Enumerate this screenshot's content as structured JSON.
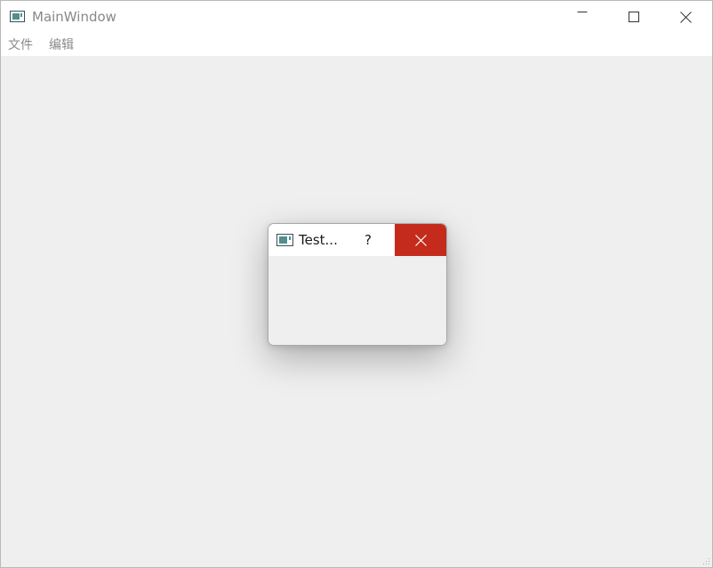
{
  "window": {
    "title": "MainWindow",
    "icon": "app-window-icon",
    "controls": {
      "minimize_icon": "minimize-icon",
      "maximize_icon": "maximize-icon",
      "close_icon": "close-icon"
    }
  },
  "menubar": {
    "items": [
      {
        "label": "文件"
      },
      {
        "label": "编辑"
      }
    ]
  },
  "dialog": {
    "title": "Test...",
    "help_label": "?",
    "icon": "app-window-icon",
    "close_icon": "close-icon",
    "close_hover_color": "#c42b1c"
  },
  "colors": {
    "client_background": "#efefef",
    "titlebar_background": "#ffffff"
  }
}
